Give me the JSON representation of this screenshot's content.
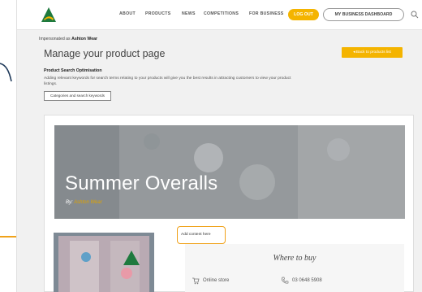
{
  "nav": {
    "items": [
      "ABOUT",
      "PRODUCTS",
      "NEWS",
      "COMPETITIONS",
      "FOR BUSINESS"
    ],
    "logout_label": "LOG OUT",
    "dashboard_label": "MY BUSINESS DASHBOARD"
  },
  "header": {
    "impersonated_prefix": "Impersonated as",
    "impersonated_name": "Ashton Wear",
    "title": "Manage your product page",
    "back_label": "Back to products list",
    "pso_title": "Product Search Optimisation",
    "pso_desc": "Adding relevant keywords for search terms relating to your products will give you the best results in attracting customers to view your product listings.",
    "keywords_button": "Categories and search keywords"
  },
  "product": {
    "name": "Summer Overalls",
    "by_prefix": "By",
    "brand": "Ashton Wear",
    "add_content_label": "Add content here",
    "where_to_buy": {
      "title": "Where to buy",
      "store_label": "Online store",
      "phone": "03 0648 5908"
    }
  },
  "colors": {
    "accent": "#f4b400",
    "annotation": "#f0a21a",
    "logo_green": "#1e7a3e"
  }
}
